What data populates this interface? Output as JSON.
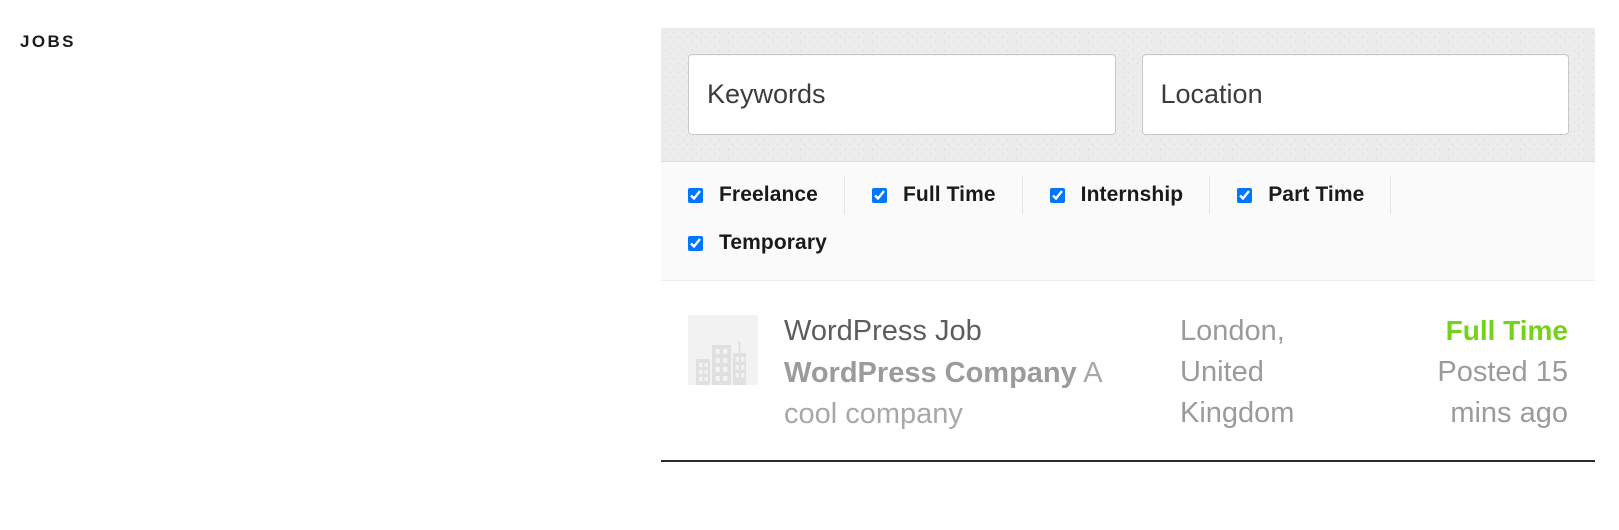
{
  "page": {
    "title": "JOBS"
  },
  "search": {
    "keywords": {
      "placeholder": "Keywords",
      "value": ""
    },
    "location": {
      "placeholder": "Location",
      "value": ""
    }
  },
  "filters": {
    "row1": [
      {
        "label": "Freelance",
        "checked": true
      },
      {
        "label": "Full Time",
        "checked": true
      },
      {
        "label": "Internship",
        "checked": true
      },
      {
        "label": "Part Time",
        "checked": true
      }
    ],
    "row2": [
      {
        "label": "Temporary",
        "checked": true
      }
    ]
  },
  "jobs": [
    {
      "title": "WordPress Job",
      "company": "WordPress Company",
      "tagline": "A cool company",
      "location": "London, United Kingdom",
      "type": "Full Time",
      "posted": "Posted 15 mins ago",
      "logo_icon": "company-buildings-placeholder-icon"
    }
  ],
  "colors": {
    "accent_green": "#76d11b",
    "form_background": "#ececec",
    "filter_background": "#fafafa",
    "muted_text": "#9b9b9b",
    "title_text": "#5d5d5d"
  }
}
